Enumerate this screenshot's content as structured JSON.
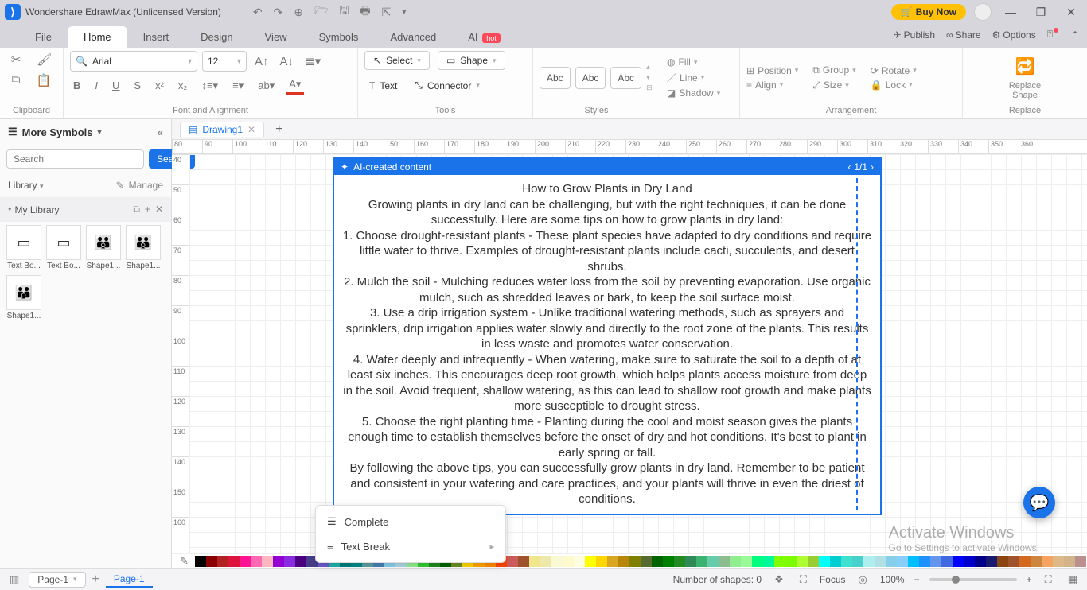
{
  "titlebar": {
    "app_title": "Wondershare EdrawMax (Unlicensed Version)",
    "buy_now": "Buy Now"
  },
  "menu": {
    "tabs": [
      "File",
      "Home",
      "Insert",
      "Design",
      "View",
      "Symbols",
      "Advanced",
      "AI"
    ],
    "ai_tag": "hot",
    "right": {
      "publish": "Publish",
      "share": "Share",
      "options": "Options"
    }
  },
  "ribbon": {
    "clipboard_label": "Clipboard",
    "font_label": "Font and Alignment",
    "font_name": "Arial",
    "font_size": "12",
    "tools_label": "Tools",
    "select": "Select",
    "shape": "Shape",
    "text": "Text",
    "connector": "Connector",
    "styles_label": "Styles",
    "abc": "Abc",
    "fill": "Fill",
    "line": "Line",
    "shadow": "Shadow",
    "arrangement_label": "Arrangement",
    "position": "Position",
    "align": "Align",
    "group": "Group",
    "size": "Size",
    "rotate": "Rotate",
    "lock": "Lock",
    "replace_shape": "Replace\nShape",
    "replace_label": "Replace"
  },
  "left": {
    "more_symbols": "More Symbols",
    "search_placeholder": "Search",
    "search_btn": "Search",
    "library": "Library",
    "manage": "Manage",
    "my_library": "My Library",
    "thumbs": [
      {
        "cap": "Text Bo..."
      },
      {
        "cap": "Text Bo..."
      },
      {
        "cap": "Shape1..."
      },
      {
        "cap": "Shape1..."
      },
      {
        "cap": "Shape1..."
      }
    ]
  },
  "doc": {
    "tab": "Drawing1"
  },
  "ruler_h": [
    "80",
    "90",
    "100",
    "110",
    "120",
    "130",
    "140",
    "150",
    "160",
    "170",
    "180",
    "190",
    "200",
    "210",
    "220",
    "230",
    "240",
    "250",
    "260",
    "270",
    "280",
    "290",
    "300",
    "310",
    "320",
    "330",
    "340",
    "350",
    "360"
  ],
  "ruler_v": [
    "40",
    "50",
    "60",
    "70",
    "80",
    "90",
    "100",
    "110",
    "120",
    "130",
    "140",
    "150",
    "160"
  ],
  "ai": {
    "header": "AI-created content",
    "pager": "1/1",
    "paragraphs": [
      "How to Grow Plants in Dry Land",
      "Growing plants in dry land can be challenging, but with the right techniques, it can be done successfully. Here are some tips on how to grow plants in dry land:",
      "1. Choose drought-resistant plants - These plant species have adapted to dry conditions and require little water to thrive. Examples of drought-resistant plants include cacti, succulents, and desert shrubs.",
      "2. Mulch the soil - Mulching reduces water loss from the soil by preventing evaporation. Use organic mulch, such as shredded leaves or bark, to keep the soil surface moist.",
      "3. Use a drip irrigation system - Unlike traditional watering methods, such as sprayers and sprinklers, drip irrigation applies water slowly and directly to the root zone of the plants. This results in less waste and promotes water conservation.",
      "4. Water deeply and infrequently - When watering, make sure to saturate the soil to a depth of at least six inches. This encourages deep root growth, which helps plants access moisture from deep in the soil. Avoid frequent, shallow watering, as this can lead to shallow root growth and make plants more susceptible to drought stress.",
      "5. Choose the right planting time - Planting during the cool and moist season gives the plants enough time to establish themselves before the onset of dry and hot conditions. It's best to plant in early spring or fall.",
      "By following the above tips, you can successfully grow plants in dry land. Remember to be patient and consistent in your watering and care practices, and your plants will thrive in even the driest of conditions."
    ]
  },
  "ai_menu": {
    "complete": "Complete",
    "text_break": "Text Break"
  },
  "palette": [
    "#000000",
    "#8b0000",
    "#b22222",
    "#dc143c",
    "#ff1493",
    "#ff69b4",
    "#ffb6c1",
    "#9400d3",
    "#8a2be2",
    "#4b0082",
    "#483d8b",
    "#6a5acd",
    "#20b2aa",
    "#008080",
    "#008b8b",
    "#5f9ea0",
    "#4682b4",
    "#87ceeb",
    "#add8e6",
    "#90ee90",
    "#32cd32",
    "#228b22",
    "#006400",
    "#6b8e23",
    "#ffd700",
    "#ffa500",
    "#ff8c00",
    "#ff4500",
    "#cd5c5c",
    "#a0522d"
  ],
  "palette2": [
    "#f0e68c",
    "#eee8aa",
    "#fafad2",
    "#fffacd",
    "#ffffe0",
    "#ffff00",
    "#ffd700",
    "#daa520",
    "#b8860b",
    "#808000",
    "#556b2f",
    "#006400",
    "#008000",
    "#228b22",
    "#2e8b57",
    "#3cb371",
    "#66cdaa",
    "#8fbc8f",
    "#90ee90",
    "#98fb98",
    "#00ff7f",
    "#00fa9a",
    "#7fff00",
    "#7cfc00",
    "#adff2f",
    "#9acd32",
    "#00ffff",
    "#00ced1",
    "#40e0d0",
    "#48d1cc",
    "#afeeee",
    "#b0e0e6",
    "#87ceeb",
    "#87cefa",
    "#00bfff",
    "#1e90ff",
    "#6495ed",
    "#4169e1",
    "#0000ff",
    "#0000cd",
    "#00008b",
    "#191970",
    "#8b4513",
    "#a0522d",
    "#d2691e",
    "#cd853f",
    "#f4a460",
    "#deb887",
    "#d2b48c",
    "#bc8f8f",
    "#ffffff",
    "#f5f5f5",
    "#dcdcdc",
    "#c0c0c0",
    "#a9a9a9",
    "#808080",
    "#696969",
    "#2f4f4f"
  ],
  "status": {
    "page_sel": "Page-1",
    "page_tab": "Page-1",
    "shapes": "Number of shapes: 0",
    "focus": "Focus",
    "zoom": "100%"
  },
  "watermark": {
    "title": "Activate Windows",
    "sub": "Go to Settings to activate Windows."
  }
}
